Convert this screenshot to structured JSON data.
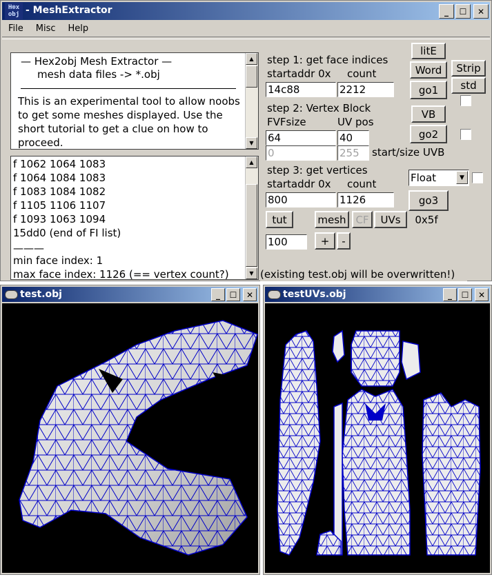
{
  "main_window": {
    "icon_text_1": "H⊗x",
    "icon_text_2": "obj",
    "title": "- MeshExtractor",
    "menu": [
      "File",
      "Misc",
      "Help"
    ]
  },
  "info_text": {
    "header_line1": "—   Hex2obj Mesh Extractor   —",
    "header_line2": "mesh data files -> *.obj",
    "body": "This is an experimental tool to allow noobs to get some meshes displayed. Use the short tutorial to get a clue on how to proceed."
  },
  "log_lines": [
    "f  1062 1064 1083",
    "f  1064 1084 1083",
    "f  1083 1084 1082",
    "f  1105 1106 1107",
    "f  1093 1063 1094",
    "15dd0 (end of FI list)",
    "———",
    "min face index: 1",
    "max face index: 1126 (== vertex count?)"
  ],
  "step1": {
    "title": "step 1: get face indices",
    "startaddr_label": "startaddr 0x",
    "count_label": "count",
    "startaddr_value": "14c88",
    "count_value": "2212",
    "go_label": "go1"
  },
  "step2": {
    "title": "step 2: Vertex Block",
    "fvf_label": "FVFsize",
    "uv_label": "UV pos",
    "fvf_value": "64",
    "uv_value": "40",
    "uvb_start": "0",
    "uvb_size": "255",
    "uvb_label": "start/size UVB",
    "go_label": "go2"
  },
  "step3": {
    "title": "step 3: get vertices",
    "startaddr_label": "startaddr 0x",
    "count_label": "count",
    "startaddr_value": "800",
    "count_value": "1126",
    "go_label": "go3",
    "type_select": "Float"
  },
  "buttons": {
    "litE": "litE",
    "word": "Word",
    "strip": "Strip",
    "std": "std",
    "vb": "VB",
    "tut": "tut",
    "mesh": "mesh",
    "cf": "CF",
    "uvs": "UVs",
    "hex_label": "0x5f",
    "scale_value": "100",
    "plus": "+",
    "minus": "-"
  },
  "warning": "(existing test.obj will be overwritten!)",
  "child_windows": {
    "left_title": "test.obj",
    "right_title": "testUVs.obj"
  },
  "colors": {
    "title_start": "#0a246a",
    "title_end": "#a6caf0",
    "mesh_fill": "#e6e6e6",
    "mesh_edge": "#0000c8",
    "canvas_bg": "#000000"
  }
}
